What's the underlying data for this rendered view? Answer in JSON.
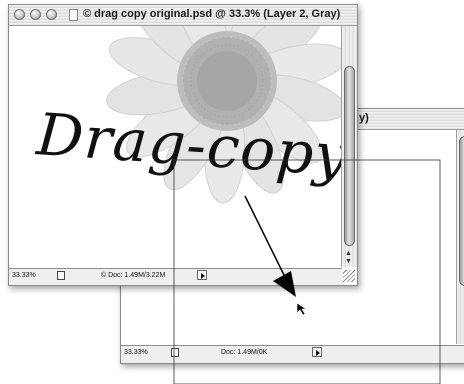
{
  "back_window": {
    "title_fragment": "y)",
    "status": {
      "zoom": "33.33%",
      "doc": "Doc: 1.49M/0K"
    }
  },
  "front_window": {
    "title": "© drag copy original.psd @ 33.3% (Layer 2, Gray)",
    "artwork_text": "Drag-copy",
    "status": {
      "zoom": "33.33%",
      "doc": "© Doc: 1.49M/3.22M"
    }
  },
  "icons": {
    "close": "close-icon",
    "minimize": "minimize-icon",
    "zoom": "zoom-icon",
    "document": "document-icon",
    "status_menu": "triangle-right-icon",
    "cursor": "arrow-cursor-icon"
  },
  "colors": {
    "window_bg": "#ffffff",
    "chrome": "#dcdcdc",
    "status_bar": "#efefef",
    "sunflower": "#b4b4b4"
  }
}
